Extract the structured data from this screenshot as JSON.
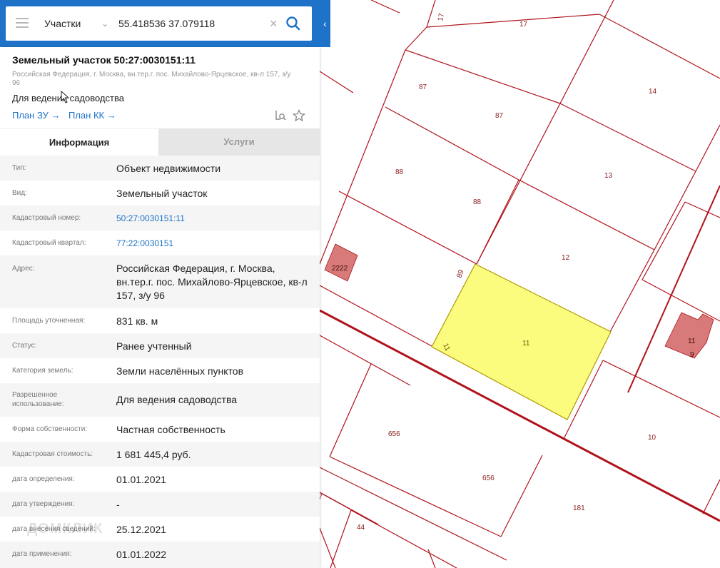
{
  "search": {
    "type_label": "Участки",
    "coordinates": "55.418536 37.079118"
  },
  "header": {
    "title": "Земельный участок 50:27:0030151:11",
    "address": "Российская Федерация, г. Москва, вн.тер.г. пос. Михайлово-Ярцевское, кв-л 157, з/у 96",
    "usage": "Для ведения садоводства",
    "plan_zu": "План ЗУ →",
    "plan_kk": "План КК →"
  },
  "tabs": {
    "info": "Информация",
    "services": "Услуги"
  },
  "rows": [
    {
      "label": "Тип:",
      "value": "Объект недвижимости"
    },
    {
      "label": "Вид:",
      "value": "Земельный участок"
    },
    {
      "label": "Кадастровый номер:",
      "value": "50:27:0030151:11",
      "link": true
    },
    {
      "label": "Кадастровый квартал:",
      "value": "77:22:0030151",
      "link": true
    },
    {
      "label": "Адрес:",
      "value": "Российская Федерация, г. Москва, вн.тер.г. пос. Михайлово-Ярцевское, кв-л 157, з/у 96"
    },
    {
      "label": "Площадь уточненная:",
      "value": "831 кв. м"
    },
    {
      "label": "Статус:",
      "value": "Ранее учтенный"
    },
    {
      "label": "Категория земель:",
      "value": "Земли населённых пунктов"
    },
    {
      "label": "Разрешенное использование:",
      "value": "Для ведения садоводства"
    },
    {
      "label": "Форма собственности:",
      "value": "Частная собственность"
    },
    {
      "label": "Кадастровая стоимость:",
      "value": "1 681 445,4 руб."
    },
    {
      "label": "дата определения:",
      "value": "01.01.2021"
    },
    {
      "label": "дата утверждения:",
      "value": "-"
    },
    {
      "label": "дата внесения сведений:",
      "value": "25.12.2021"
    },
    {
      "label": "дата применения:",
      "value": "01.01.2022"
    }
  ],
  "watermark": "ДОМКЛИК",
  "map": {
    "labels": [
      "17",
      "17",
      "87",
      "87",
      "14",
      "88",
      "88",
      "13",
      "12",
      "89",
      "2222",
      "11",
      "11",
      "11",
      "9",
      "656",
      "656",
      "10",
      "181",
      "44",
      "7"
    ]
  },
  "colors": {
    "brand_blue": "#1e73c8",
    "parcel_line": "#b0121b",
    "selected_fill": "#fbfb7e",
    "building_fill": "#d97a7a"
  }
}
